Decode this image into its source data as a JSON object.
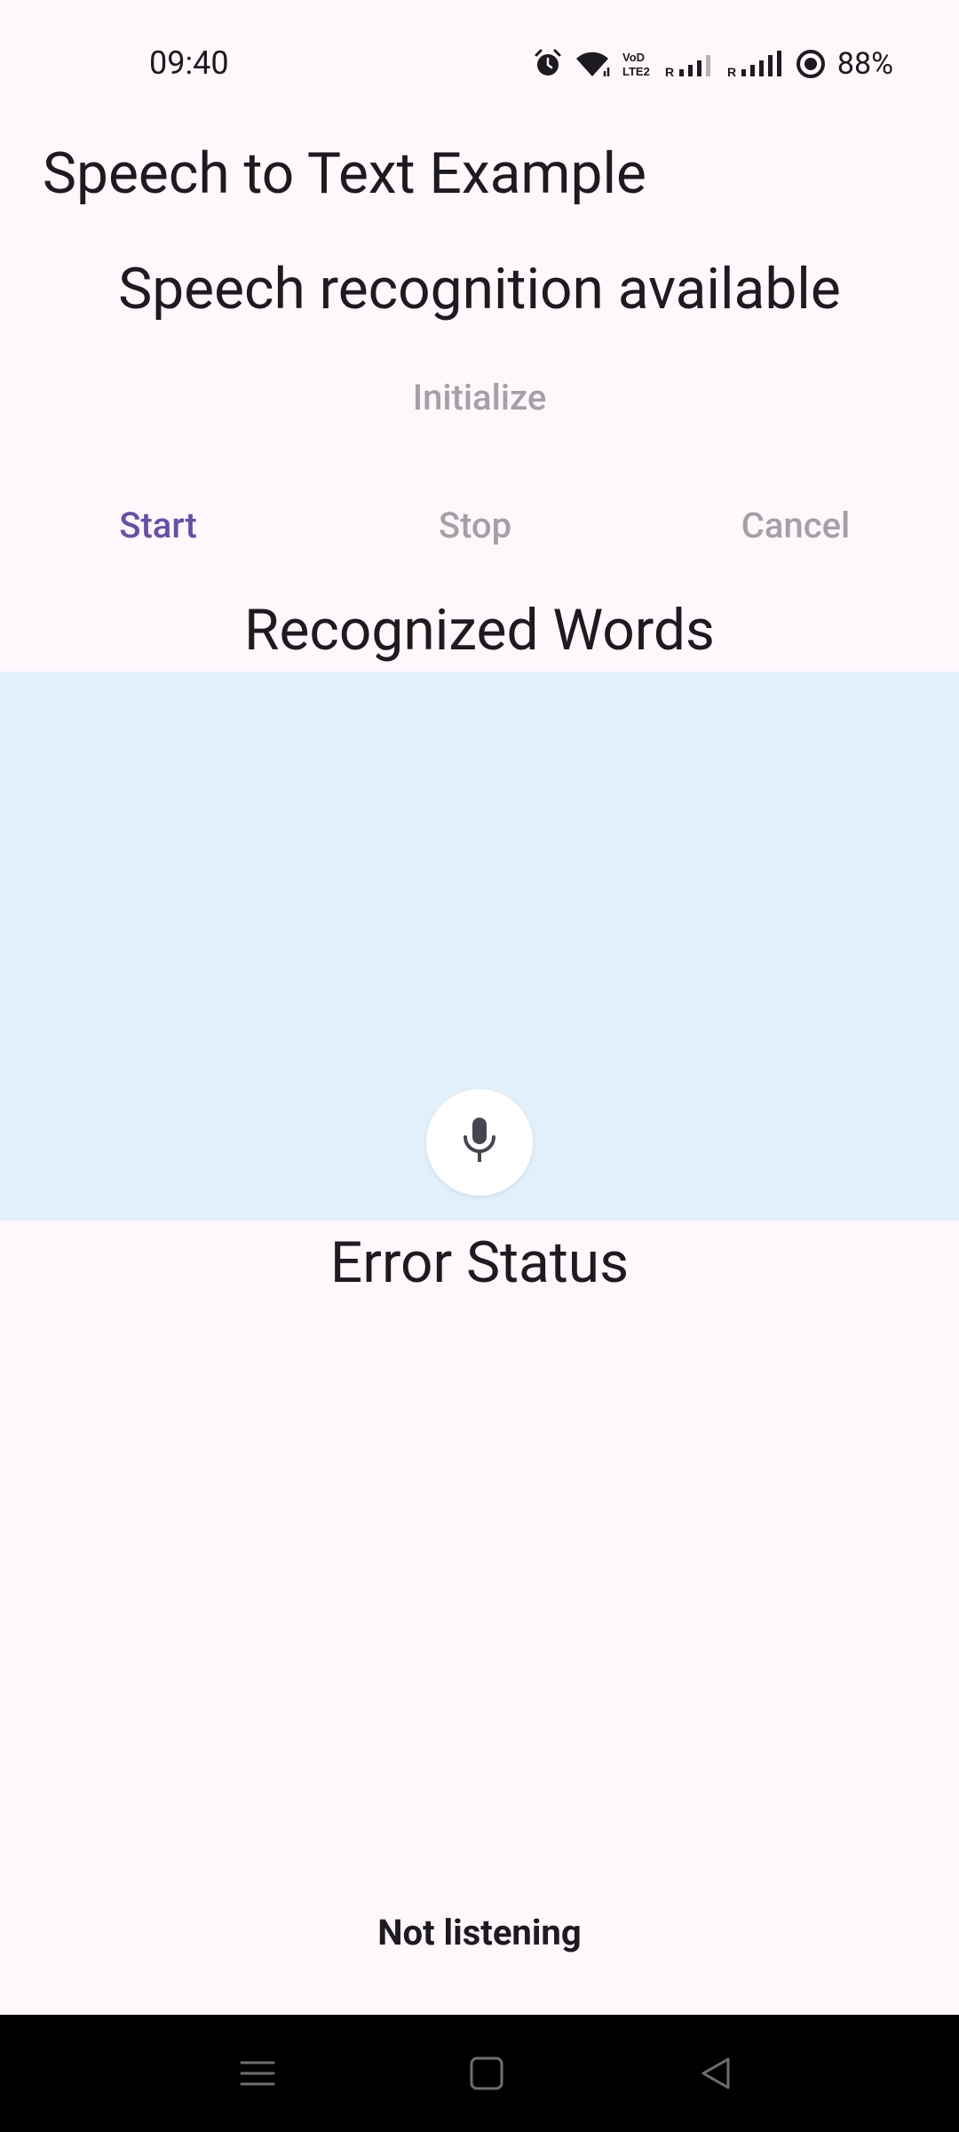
{
  "status_bar": {
    "time": "09:40",
    "battery": "88%",
    "icons": [
      "alarm-icon",
      "wifi-icon",
      "volte-icon",
      "signal-icon",
      "signal-icon",
      "battery-saver-icon"
    ]
  },
  "app_bar": {
    "title": "Speech to Text Example"
  },
  "availability": "Speech recognition available",
  "buttons": {
    "initialize": "Initialize",
    "start": "Start",
    "stop": "Stop",
    "cancel": "Cancel"
  },
  "recognized": {
    "title": "Recognized Words",
    "text": ""
  },
  "error": {
    "title": "Error Status",
    "text": ""
  },
  "listening_status": "Not listening",
  "colors": {
    "background": "#fef7fb",
    "accent": "#6750a4",
    "disabled": "#a4a1a6",
    "words_area": "#e2f0fb",
    "nav_bar": "#000000"
  },
  "nav_bar": {
    "icons": [
      "menu-icon",
      "home-icon",
      "back-icon"
    ]
  }
}
